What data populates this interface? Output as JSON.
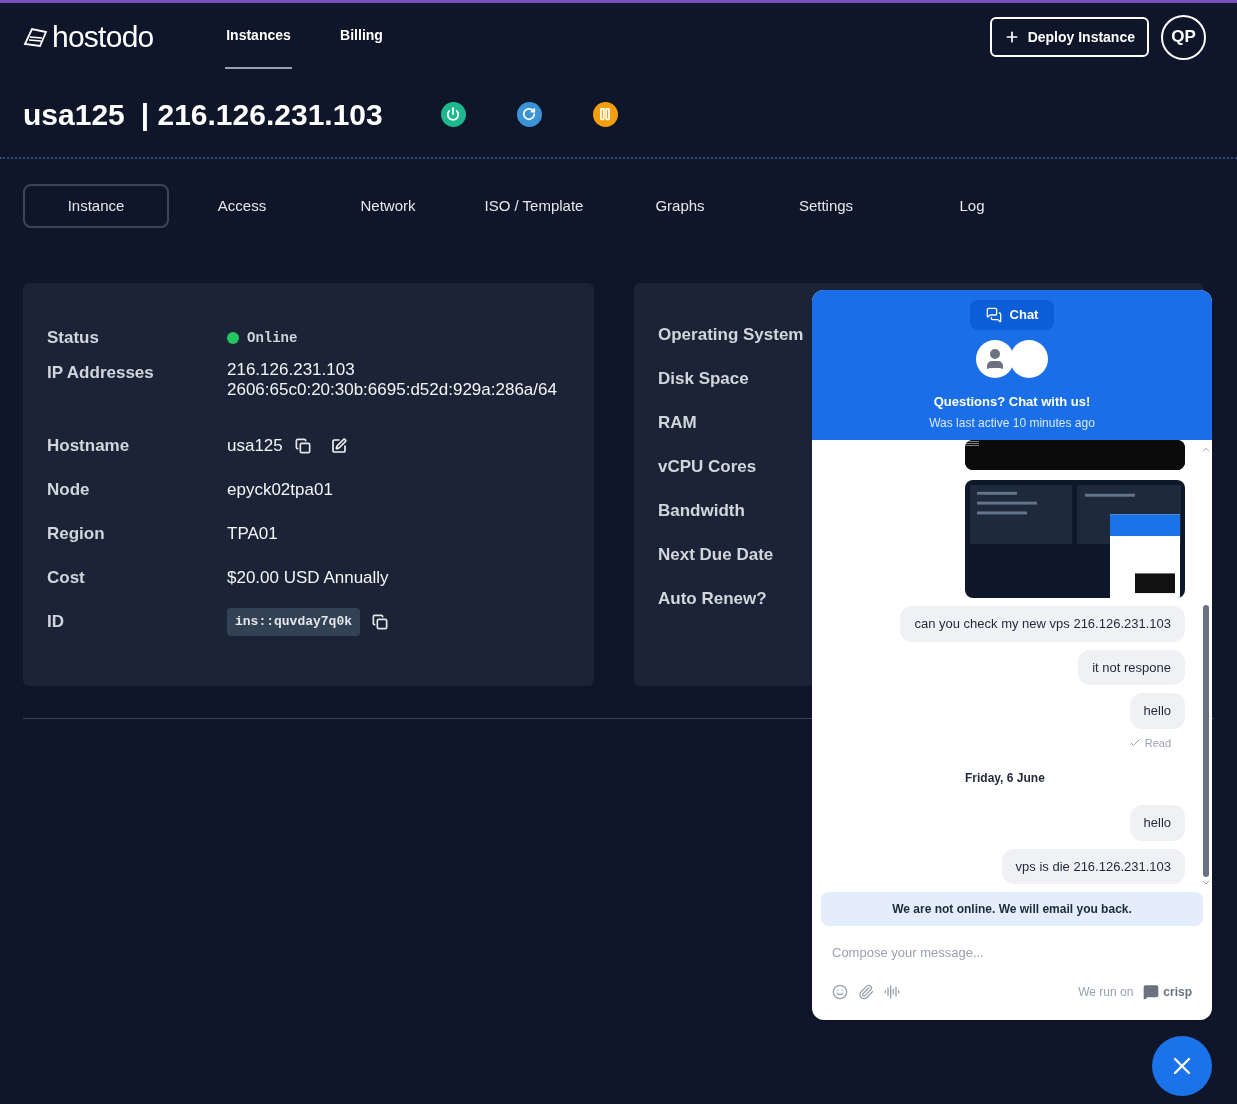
{
  "topbar": {
    "logo": "hostodo",
    "nav": [
      {
        "label": "Instances",
        "selected": true
      },
      {
        "label": "Billing",
        "selected": false
      }
    ],
    "deploy_button": "Deploy Instance",
    "avatar": "QP"
  },
  "header": {
    "hostname": "usa125",
    "ip": "| 216.126.231.103",
    "actions": [
      {
        "kind": "power",
        "color": "#1fb88e"
      },
      {
        "kind": "restart",
        "color": "#3b93d8"
      },
      {
        "kind": "pause",
        "color": "#f59e0b"
      }
    ]
  },
  "tabs": [
    {
      "label": "Instance",
      "selected": true
    },
    {
      "label": "Access",
      "selected": false
    },
    {
      "label": "Network",
      "selected": false
    },
    {
      "label": "ISO / Template",
      "selected": false
    },
    {
      "label": "Graphs",
      "selected": false
    },
    {
      "label": "Settings",
      "selected": false
    },
    {
      "label": "Log",
      "selected": false
    }
  ],
  "details": [
    {
      "kind": "status",
      "label": "Status",
      "value": "Online",
      "color": "#22c55e"
    },
    {
      "kind": "multi",
      "label": "IP Addresses",
      "values": [
        "216.126.231.103",
        "2606:65c0:20:30b:6695:d52d:929a:286a/64"
      ]
    },
    {
      "kind": "editable",
      "label": "Hostname",
      "value": "usa125"
    },
    {
      "kind": "text",
      "label": "Node",
      "value": "epyck02tpa01"
    },
    {
      "kind": "text",
      "label": "Region",
      "value": "TPA01"
    },
    {
      "kind": "text",
      "label": "Cost",
      "value": "$20.00 USD Annually"
    },
    {
      "kind": "code",
      "label": "ID",
      "value": "ins::quvday7q0k"
    }
  ],
  "specs": [
    "Operating System",
    "Disk Space",
    "RAM",
    "vCPU Cores",
    "Bandwidth",
    "Next Due Date",
    "Auto Renew?"
  ],
  "chat": {
    "tab": "Chat",
    "title": "Questions? Chat with us!",
    "subtitle": "Was last active 10 minutes ago",
    "messages": [
      {
        "kind": "picture"
      },
      {
        "kind": "picture"
      },
      {
        "kind": "text",
        "text": "can you check my new vps 216.126.231.103"
      },
      {
        "kind": "text",
        "text": "it not respone"
      },
      {
        "kind": "text",
        "text": "hello"
      },
      {
        "kind": "receipt",
        "text": "Read"
      },
      {
        "kind": "date",
        "text": "Friday, 6 June"
      },
      {
        "kind": "text",
        "text": "hello"
      },
      {
        "kind": "text",
        "text": "vps is die 216.126.231.103"
      }
    ],
    "notice": "We are not online. We will email you back.",
    "placeholder": "Compose your message...",
    "powered": "We run on",
    "brand": "crisp"
  }
}
